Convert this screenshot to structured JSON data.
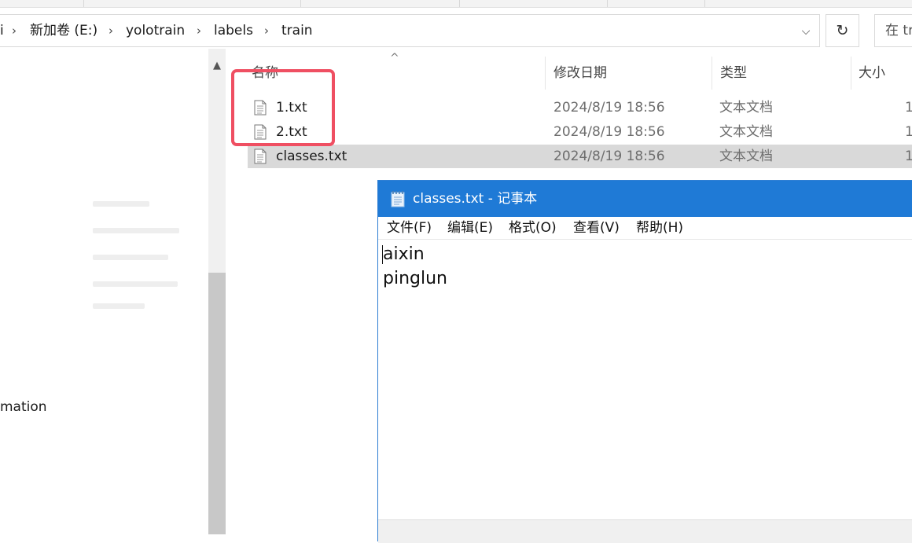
{
  "address_bar": {
    "crumbs": [
      "i",
      "新加卷 (E:)",
      "yolotrain",
      "labels",
      "train"
    ],
    "search_placeholder": "在 tr"
  },
  "nav_pane": {
    "partial_label": "mation"
  },
  "columns": {
    "name": "名称",
    "date": "修改日期",
    "type": "类型",
    "size": "大小"
  },
  "files": [
    {
      "name": "1.txt",
      "date": "2024/8/19 18:56",
      "type": "文本文档",
      "size": "1",
      "selected": false
    },
    {
      "name": "2.txt",
      "date": "2024/8/19 18:56",
      "type": "文本文档",
      "size": "1",
      "selected": false
    },
    {
      "name": "classes.txt",
      "date": "2024/8/19 18:56",
      "type": "文本文档",
      "size": "1",
      "selected": true
    }
  ],
  "notepad": {
    "title": "classes.txt - 记事本",
    "menu": [
      "文件(F)",
      "编辑(E)",
      "格式(O)",
      "查看(V)",
      "帮助(H)"
    ],
    "content": "aixin\npinglun"
  },
  "colors": {
    "highlight": "#ef4f62",
    "title_bar": "#1f7ad6",
    "selected_row": "#d9d9d9"
  }
}
